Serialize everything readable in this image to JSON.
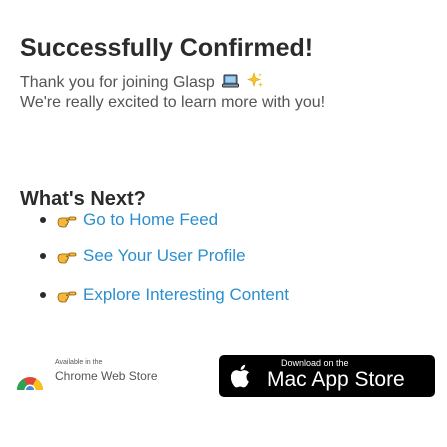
{
  "confirmation": {
    "title": "Successfully Confirmed!",
    "line1": "Thank you for joining Glasp",
    "line2": "We're really excited to learn more with you!"
  },
  "next_steps": {
    "heading": "What's Next?",
    "items": [
      {
        "label": "Go to Home Feed"
      },
      {
        "label": "See Your User Profile"
      },
      {
        "label": "Explore Interesting Content"
      }
    ]
  },
  "badges": {
    "chrome": {
      "small_text": "Available in the",
      "big_text": "Chrome Web Store"
    },
    "mac": {
      "small_text": "Download on the",
      "big_text": "Mac App Store"
    }
  },
  "colors": {
    "link": "#2b8fcf",
    "text": "#2b2b2b"
  },
  "icons": [
    "laptop-icon",
    "sparkle-icon",
    "pointing-hand-icon",
    "chrome-web-store-logo",
    "apple-logo-icon"
  ]
}
